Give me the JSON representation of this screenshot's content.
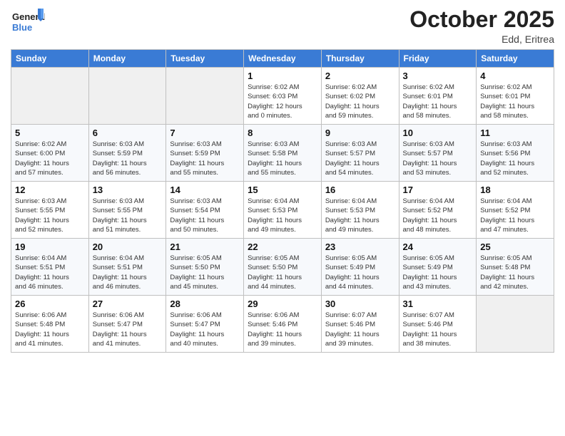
{
  "header": {
    "logo_line1": "General",
    "logo_line2": "Blue",
    "month_title": "October 2025",
    "subtitle": "Edd, Eritrea"
  },
  "weekdays": [
    "Sunday",
    "Monday",
    "Tuesday",
    "Wednesday",
    "Thursday",
    "Friday",
    "Saturday"
  ],
  "weeks": [
    [
      {
        "day": "",
        "info": ""
      },
      {
        "day": "",
        "info": ""
      },
      {
        "day": "",
        "info": ""
      },
      {
        "day": "1",
        "info": "Sunrise: 6:02 AM\nSunset: 6:03 PM\nDaylight: 12 hours\nand 0 minutes."
      },
      {
        "day": "2",
        "info": "Sunrise: 6:02 AM\nSunset: 6:02 PM\nDaylight: 11 hours\nand 59 minutes."
      },
      {
        "day": "3",
        "info": "Sunrise: 6:02 AM\nSunset: 6:01 PM\nDaylight: 11 hours\nand 58 minutes."
      },
      {
        "day": "4",
        "info": "Sunrise: 6:02 AM\nSunset: 6:01 PM\nDaylight: 11 hours\nand 58 minutes."
      }
    ],
    [
      {
        "day": "5",
        "info": "Sunrise: 6:02 AM\nSunset: 6:00 PM\nDaylight: 11 hours\nand 57 minutes."
      },
      {
        "day": "6",
        "info": "Sunrise: 6:03 AM\nSunset: 5:59 PM\nDaylight: 11 hours\nand 56 minutes."
      },
      {
        "day": "7",
        "info": "Sunrise: 6:03 AM\nSunset: 5:59 PM\nDaylight: 11 hours\nand 55 minutes."
      },
      {
        "day": "8",
        "info": "Sunrise: 6:03 AM\nSunset: 5:58 PM\nDaylight: 11 hours\nand 55 minutes."
      },
      {
        "day": "9",
        "info": "Sunrise: 6:03 AM\nSunset: 5:57 PM\nDaylight: 11 hours\nand 54 minutes."
      },
      {
        "day": "10",
        "info": "Sunrise: 6:03 AM\nSunset: 5:57 PM\nDaylight: 11 hours\nand 53 minutes."
      },
      {
        "day": "11",
        "info": "Sunrise: 6:03 AM\nSunset: 5:56 PM\nDaylight: 11 hours\nand 52 minutes."
      }
    ],
    [
      {
        "day": "12",
        "info": "Sunrise: 6:03 AM\nSunset: 5:55 PM\nDaylight: 11 hours\nand 52 minutes."
      },
      {
        "day": "13",
        "info": "Sunrise: 6:03 AM\nSunset: 5:55 PM\nDaylight: 11 hours\nand 51 minutes."
      },
      {
        "day": "14",
        "info": "Sunrise: 6:03 AM\nSunset: 5:54 PM\nDaylight: 11 hours\nand 50 minutes."
      },
      {
        "day": "15",
        "info": "Sunrise: 6:04 AM\nSunset: 5:53 PM\nDaylight: 11 hours\nand 49 minutes."
      },
      {
        "day": "16",
        "info": "Sunrise: 6:04 AM\nSunset: 5:53 PM\nDaylight: 11 hours\nand 49 minutes."
      },
      {
        "day": "17",
        "info": "Sunrise: 6:04 AM\nSunset: 5:52 PM\nDaylight: 11 hours\nand 48 minutes."
      },
      {
        "day": "18",
        "info": "Sunrise: 6:04 AM\nSunset: 5:52 PM\nDaylight: 11 hours\nand 47 minutes."
      }
    ],
    [
      {
        "day": "19",
        "info": "Sunrise: 6:04 AM\nSunset: 5:51 PM\nDaylight: 11 hours\nand 46 minutes."
      },
      {
        "day": "20",
        "info": "Sunrise: 6:04 AM\nSunset: 5:51 PM\nDaylight: 11 hours\nand 46 minutes."
      },
      {
        "day": "21",
        "info": "Sunrise: 6:05 AM\nSunset: 5:50 PM\nDaylight: 11 hours\nand 45 minutes."
      },
      {
        "day": "22",
        "info": "Sunrise: 6:05 AM\nSunset: 5:50 PM\nDaylight: 11 hours\nand 44 minutes."
      },
      {
        "day": "23",
        "info": "Sunrise: 6:05 AM\nSunset: 5:49 PM\nDaylight: 11 hours\nand 44 minutes."
      },
      {
        "day": "24",
        "info": "Sunrise: 6:05 AM\nSunset: 5:49 PM\nDaylight: 11 hours\nand 43 minutes."
      },
      {
        "day": "25",
        "info": "Sunrise: 6:05 AM\nSunset: 5:48 PM\nDaylight: 11 hours\nand 42 minutes."
      }
    ],
    [
      {
        "day": "26",
        "info": "Sunrise: 6:06 AM\nSunset: 5:48 PM\nDaylight: 11 hours\nand 41 minutes."
      },
      {
        "day": "27",
        "info": "Sunrise: 6:06 AM\nSunset: 5:47 PM\nDaylight: 11 hours\nand 41 minutes."
      },
      {
        "day": "28",
        "info": "Sunrise: 6:06 AM\nSunset: 5:47 PM\nDaylight: 11 hours\nand 40 minutes."
      },
      {
        "day": "29",
        "info": "Sunrise: 6:06 AM\nSunset: 5:46 PM\nDaylight: 11 hours\nand 39 minutes."
      },
      {
        "day": "30",
        "info": "Sunrise: 6:07 AM\nSunset: 5:46 PM\nDaylight: 11 hours\nand 39 minutes."
      },
      {
        "day": "31",
        "info": "Sunrise: 6:07 AM\nSunset: 5:46 PM\nDaylight: 11 hours\nand 38 minutes."
      },
      {
        "day": "",
        "info": ""
      }
    ]
  ]
}
